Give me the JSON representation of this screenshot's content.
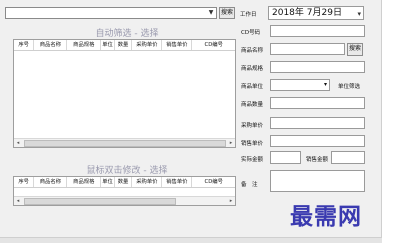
{
  "toolbar": {
    "search_label": "搜索"
  },
  "auto_filter": {
    "title": "自动筛选 - 选择",
    "columns": [
      "序号",
      "商品名称",
      "商品规格",
      "单位",
      "数量",
      "采购单价",
      "销售单价",
      "CD编号"
    ]
  },
  "edit_select": {
    "title": "鼠标双击修改 - 选择",
    "columns": [
      "序号",
      "商品名称",
      "商品规格",
      "单位",
      "数量",
      "采购单价",
      "销售单价",
      "CD编号"
    ]
  },
  "form": {
    "date_label": "工作日",
    "date_value": "2018年  7月29日",
    "cd_label": "CD号码",
    "name_label": "商品名称",
    "name_button": "搜索",
    "spec_label": "商品规格",
    "unit_label": "商品单位",
    "unit_filter_label": "单位筛选",
    "qty_label": "商品数量",
    "buy_price_label": "采购单价",
    "sell_price_label": "销售单价",
    "actual_amount_label": "实际金额",
    "sales_amount_label": "销售金额",
    "remark_label": "备　注"
  },
  "watermark": "最需网"
}
